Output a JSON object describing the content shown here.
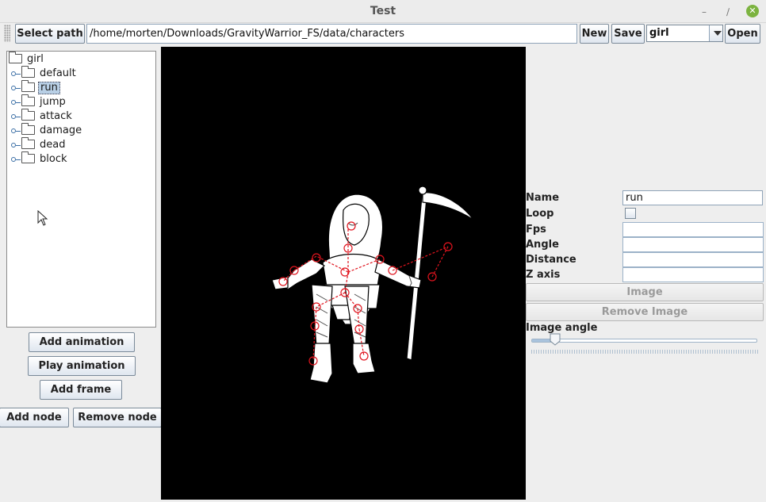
{
  "window": {
    "title": "Test"
  },
  "toolbar": {
    "select_path_label": "Select path",
    "path_value": "/home/morten/Downloads/GravityWarrior_FS/data/characters",
    "new_label": "New",
    "save_label": "Save",
    "character_value": "girl",
    "open_label": "Open"
  },
  "tree": {
    "root": "girl",
    "items": [
      "default",
      "run",
      "jump",
      "attack",
      "damage",
      "dead",
      "block"
    ],
    "selected": "run"
  },
  "left_buttons": {
    "add_animation": "Add animation",
    "play_animation": "Play animation",
    "add_frame": "Add frame",
    "add_node": "Add node",
    "remove_node": "Remove node"
  },
  "properties": {
    "name_label": "Name",
    "name_value": "run",
    "loop_label": "Loop",
    "loop_checked": false,
    "fps_label": "Fps",
    "fps_value": "",
    "angle_label": "Angle",
    "angle_value": "",
    "distance_label": "Distance",
    "distance_value": "",
    "zaxis_label": "Z axis",
    "zaxis_value": "",
    "image_button": "Image",
    "remove_image_button": "Remove Image",
    "image_angle_label": "Image angle",
    "image_angle_fraction": 0.08
  },
  "colors": {
    "canvas_bg": "#000000",
    "node_color": "#e0141e",
    "selection_bg": "#b8cfe5",
    "close_button": "#7cb340"
  },
  "icons": [
    "minimize-icon",
    "maximize-icon",
    "close-icon",
    "folder-icon",
    "tree-handle-icon",
    "mouse-cursor-icon",
    "dropdown-arrow-icon"
  ]
}
